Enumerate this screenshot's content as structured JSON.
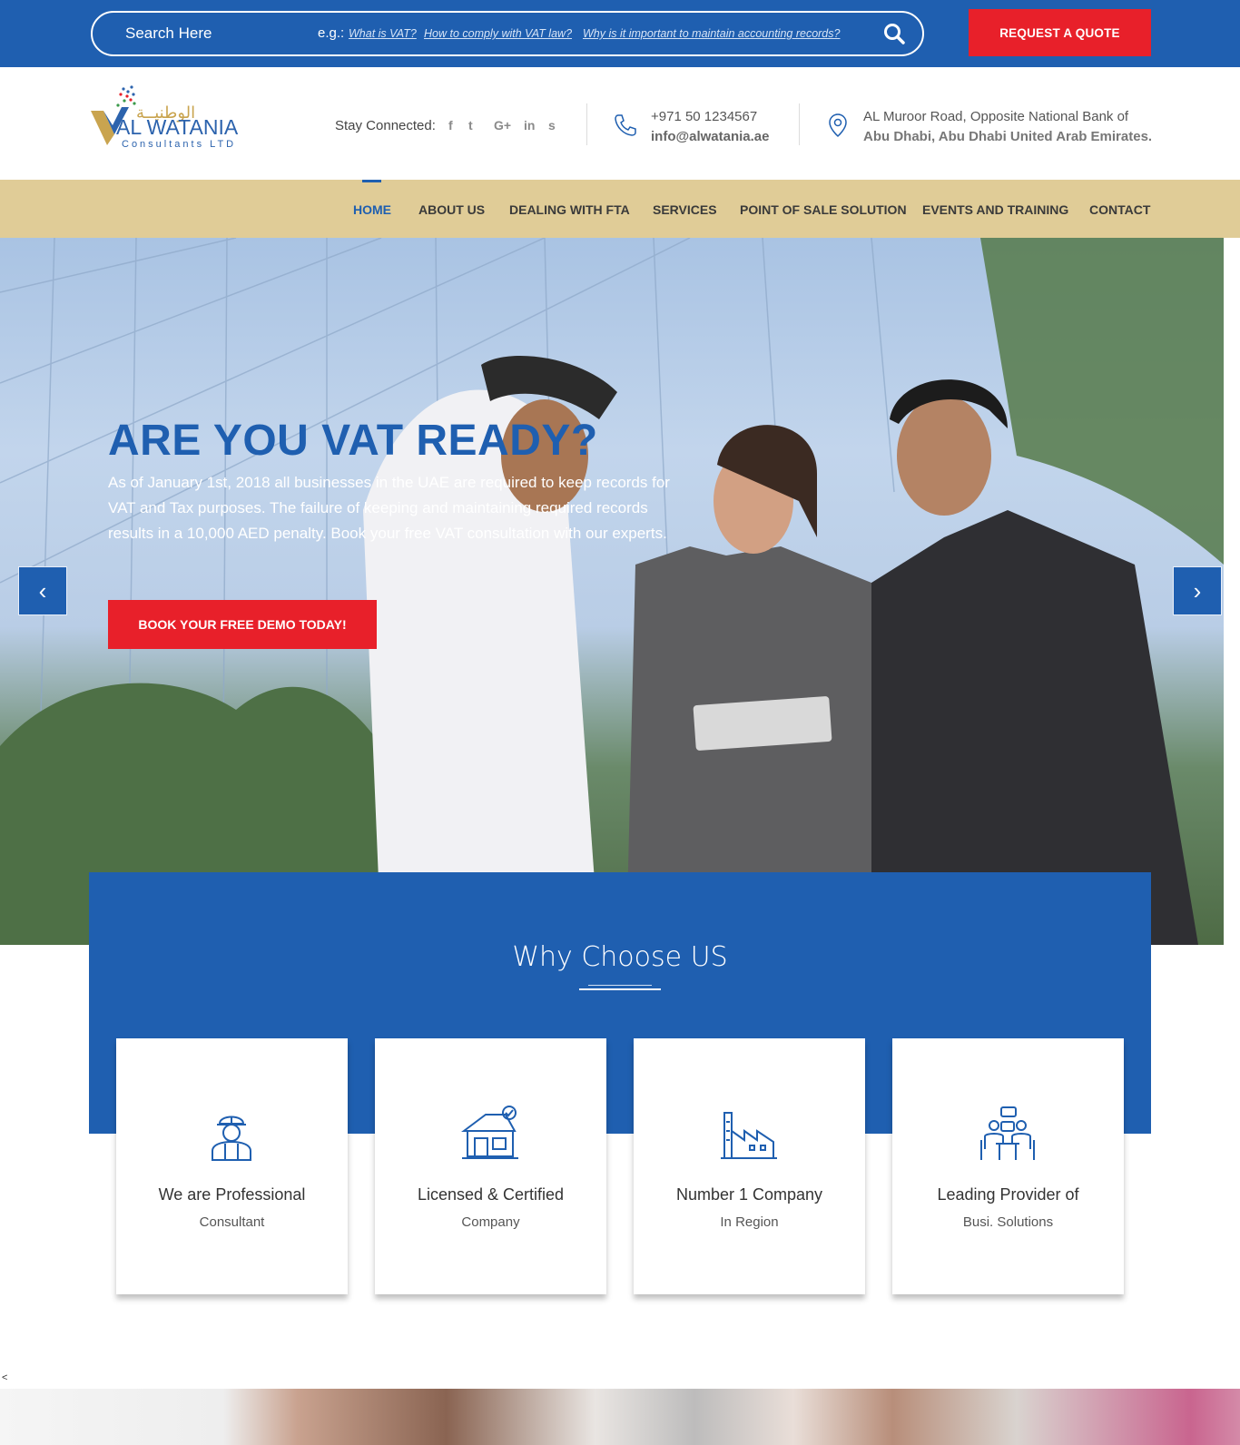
{
  "topbar": {
    "search_placeholder": "Search Here",
    "examples_label": "e.g.:",
    "examples": [
      "What is VAT?",
      "How to comply with VAT law?",
      "Why is it important to maintain accounting records?"
    ],
    "request_quote": "REQUEST A QUOTE"
  },
  "header": {
    "logo": {
      "arabic": "الوطنيــة",
      "name": "AL WATANIA",
      "sub": "Consultants LTD"
    },
    "stay_connected": "Stay Connected:",
    "social": [
      "f",
      "t",
      "G+",
      "in",
      "s"
    ],
    "phone": "+971 50 1234567",
    "email": "info@alwatania.ae",
    "address_line1": "AL Muroor Road, Opposite National Bank of",
    "address_line2": "Abu Dhabi, Abu Dhabi United Arab Emirates."
  },
  "nav": {
    "items": [
      "HOME",
      "ABOUT US",
      "DEALING WITH FTA",
      "SERVICES",
      "POINT OF SALE SOLUTION",
      "EVENTS AND TRAINING",
      "CONTACT"
    ],
    "active": "HOME"
  },
  "hero": {
    "title": "ARE YOU VAT READY?",
    "text": "As of January 1st, 2018 all businesses in the UAE are required to keep records for VAT and Tax purposes. The failure of keeping and maintaining required records results in a 10,000 AED penalty. Book your free VAT consultation with our experts.",
    "cta": "BOOK YOUR FREE DEMO TODAY!",
    "prev": "‹",
    "next": "›"
  },
  "why": {
    "title": "Why Choose US",
    "cards": [
      {
        "title": "We are Professional",
        "sub": "Consultant",
        "icon": "worker-icon"
      },
      {
        "title": "Licensed & Certified",
        "sub": "Company",
        "icon": "certified-building-icon"
      },
      {
        "title": "Number 1 Company",
        "sub": "In Region",
        "icon": "factory-icon"
      },
      {
        "title": "Leading Provider of",
        "sub": "Busi. Solutions",
        "icon": "meeting-icon"
      }
    ]
  },
  "misc": {
    "lt": "<"
  },
  "colors": {
    "brand_blue": "#1f5fb0",
    "accent_red": "#e8202a",
    "nav_gold": "#e0cc97"
  }
}
